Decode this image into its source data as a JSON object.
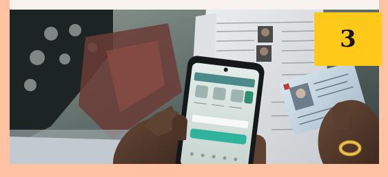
{
  "badge": {
    "number": "3"
  },
  "colors": {
    "page_background": "#ffc3a3",
    "badge_background": "#ffc91a",
    "top_strip": "#f7f2ee"
  },
  "photo": {
    "subject_icon": "smartphone-with-documents-photo"
  }
}
